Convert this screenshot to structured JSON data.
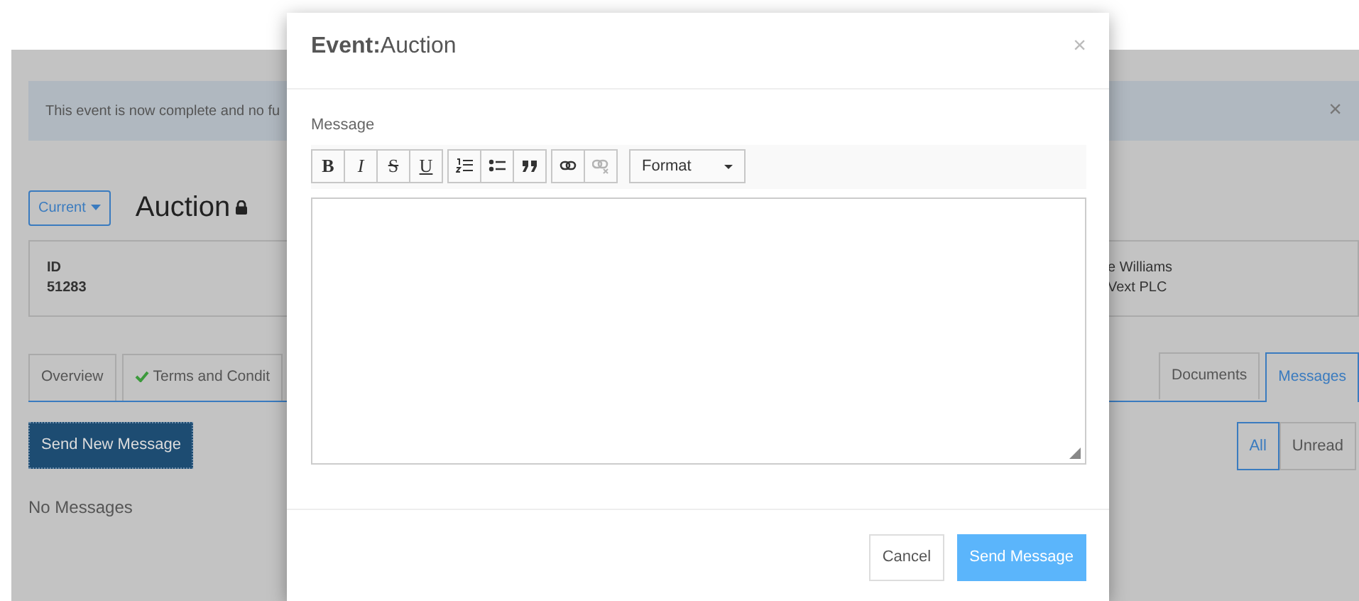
{
  "page": {
    "alert": {
      "text": "This event is now complete and no fu",
      "close": "×"
    },
    "version_button": "Current",
    "title": "Auction",
    "locked": true,
    "details_left": [
      {
        "label": "ID",
        "value": "51283"
      }
    ],
    "details_right": [
      "e Williams",
      "Vext PLC"
    ],
    "tabs_left": [
      {
        "label": "Overview",
        "selected": false,
        "checked": false
      },
      {
        "label": "Terms and Condit",
        "selected": false,
        "checked": true
      }
    ],
    "tabs_right": [
      {
        "label": "Documents",
        "selected": false,
        "checked": false
      },
      {
        "label": "Messages",
        "selected": true,
        "checked": false
      }
    ],
    "send_new_button": "Send New Message",
    "empty_text": "No Messages",
    "filters": [
      {
        "label": "All",
        "selected": true
      },
      {
        "label": "Unread",
        "selected": false
      }
    ]
  },
  "modal": {
    "title": "**Event:**Auction",
    "close": "×",
    "field_label": "Message",
    "toolbar": [
      {
        "items": [
          {
            "kind": "bold",
            "label": "B"
          },
          {
            "kind": "italic",
            "label": "I"
          },
          {
            "kind": "strike",
            "label": "S"
          },
          {
            "kind": "underline",
            "label": "U"
          }
        ]
      },
      {
        "items": [
          {
            "kind": "ordered-list",
            "disabled": false
          },
          {
            "kind": "bullet-list",
            "disabled": false
          },
          {
            "kind": "quote",
            "disabled": false
          }
        ]
      },
      {
        "items": [
          {
            "kind": "link",
            "disabled": false
          },
          {
            "kind": "unlink",
            "disabled": true
          }
        ]
      }
    ],
    "format_dropdown": "Format",
    "buttons": [
      {
        "label": "Cancel",
        "kind": "secondary"
      },
      {
        "label": "Send Message",
        "kind": "primary"
      }
    ]
  }
}
